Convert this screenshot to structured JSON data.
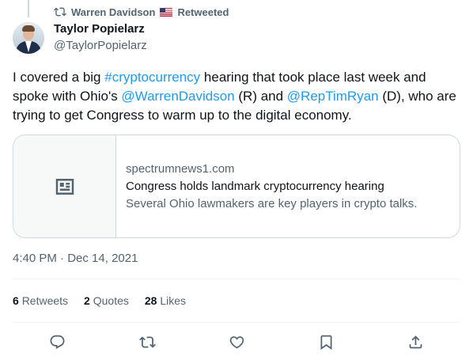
{
  "retweet": {
    "by": "Warren Davidson",
    "label": "Retweeted"
  },
  "author": {
    "name": "Taylor Popielarz",
    "handle": "@TaylorPopielarz"
  },
  "tweet": {
    "text_1": "I covered a big ",
    "hashtag": "#cryptocurrency",
    "text_2": " hearing that took place last week and spoke with Ohio's ",
    "mention_1": "@WarrenDavidson",
    "text_3": " (R) and ",
    "mention_2": "@RepTimRyan",
    "text_4": " (D), who are trying to get Congress to warm up to the digital economy."
  },
  "card": {
    "domain": "spectrumnews1.com",
    "title": "Congress holds landmark cryptocurrency hearing",
    "description": "Several Ohio lawmakers are key players in crypto talks.",
    "thumbnail_icon": "news-article-icon"
  },
  "meta": {
    "time": "4:40 PM",
    "separator": " · ",
    "date": "Dec 14, 2021"
  },
  "stats": {
    "retweets_count": "6",
    "retweets_label": "Retweets",
    "quotes_count": "2",
    "quotes_label": "Quotes",
    "likes_count": "28",
    "likes_label": "Likes"
  },
  "actions": [
    "reply-icon",
    "retweet-icon",
    "like-icon",
    "bookmark-icon",
    "share-icon"
  ],
  "colors": {
    "link": "#1d9bf0",
    "secondary_text": "#536471",
    "primary_text": "#0f1419",
    "border": "#cfd9de"
  }
}
